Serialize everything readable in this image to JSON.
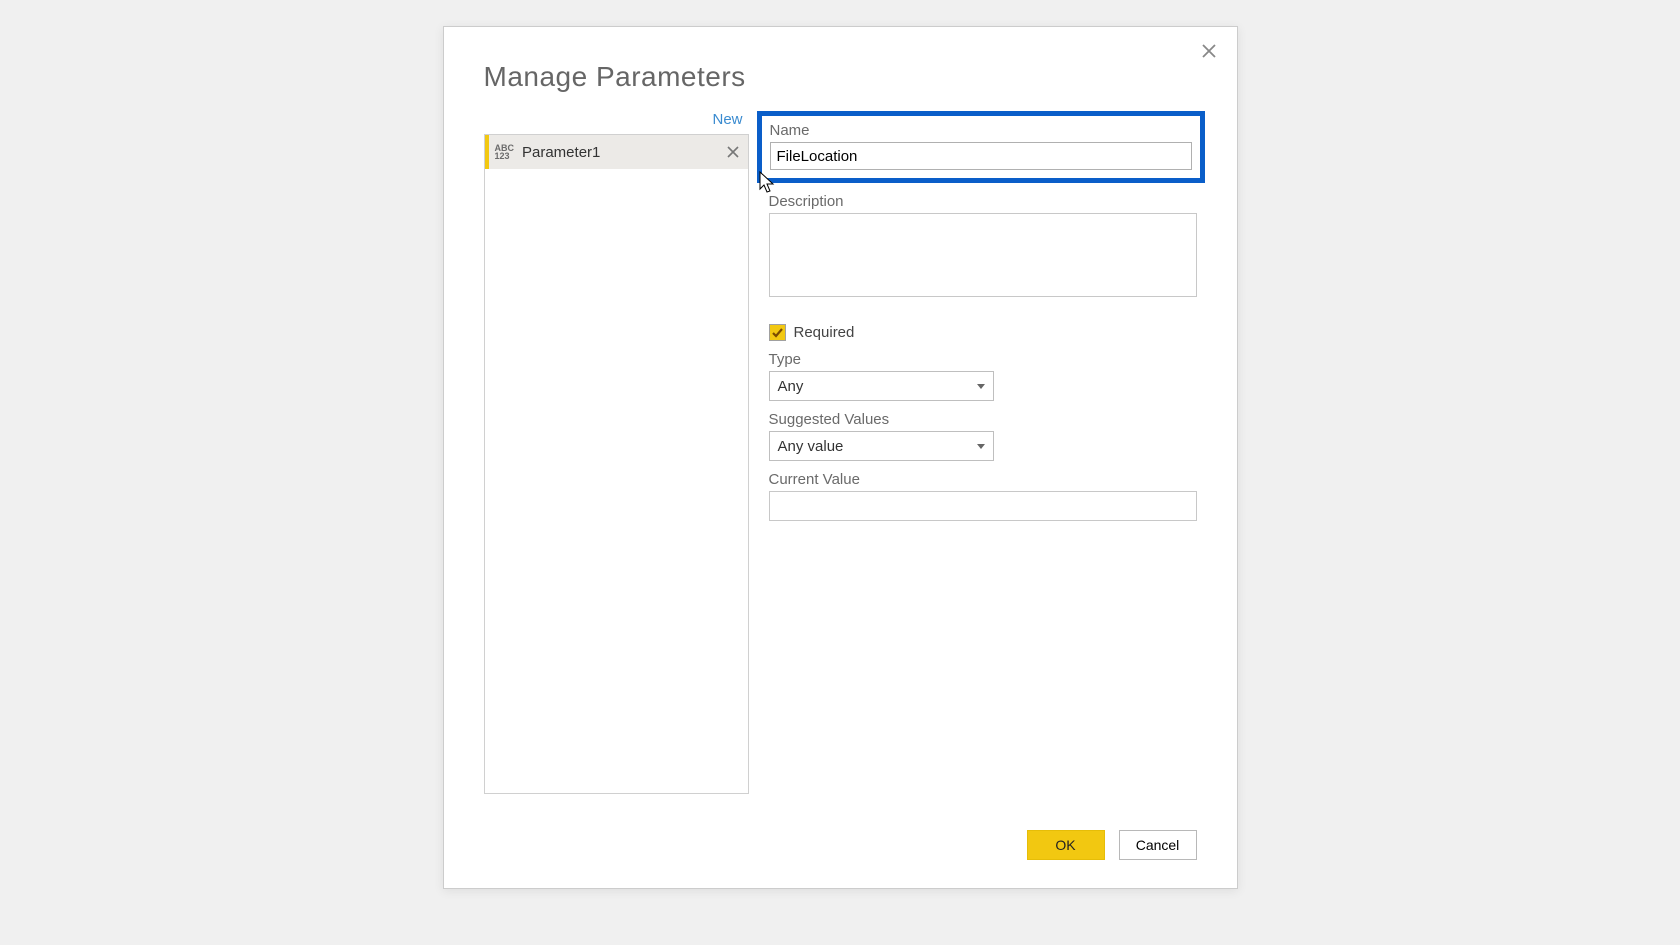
{
  "dialog": {
    "title": "Manage Parameters",
    "new_label": "New",
    "ok_label": "OK",
    "cancel_label": "Cancel"
  },
  "parameters": [
    {
      "name": "Parameter1",
      "icon_top": "ABC",
      "icon_bottom": "123"
    }
  ],
  "form": {
    "name_label": "Name",
    "name_value": "FileLocation",
    "description_label": "Description",
    "description_value": "",
    "required_label": "Required",
    "required_checked": true,
    "type_label": "Type",
    "type_value": "Any",
    "suggested_label": "Suggested Values",
    "suggested_value": "Any value",
    "current_value_label": "Current Value",
    "current_value": ""
  }
}
